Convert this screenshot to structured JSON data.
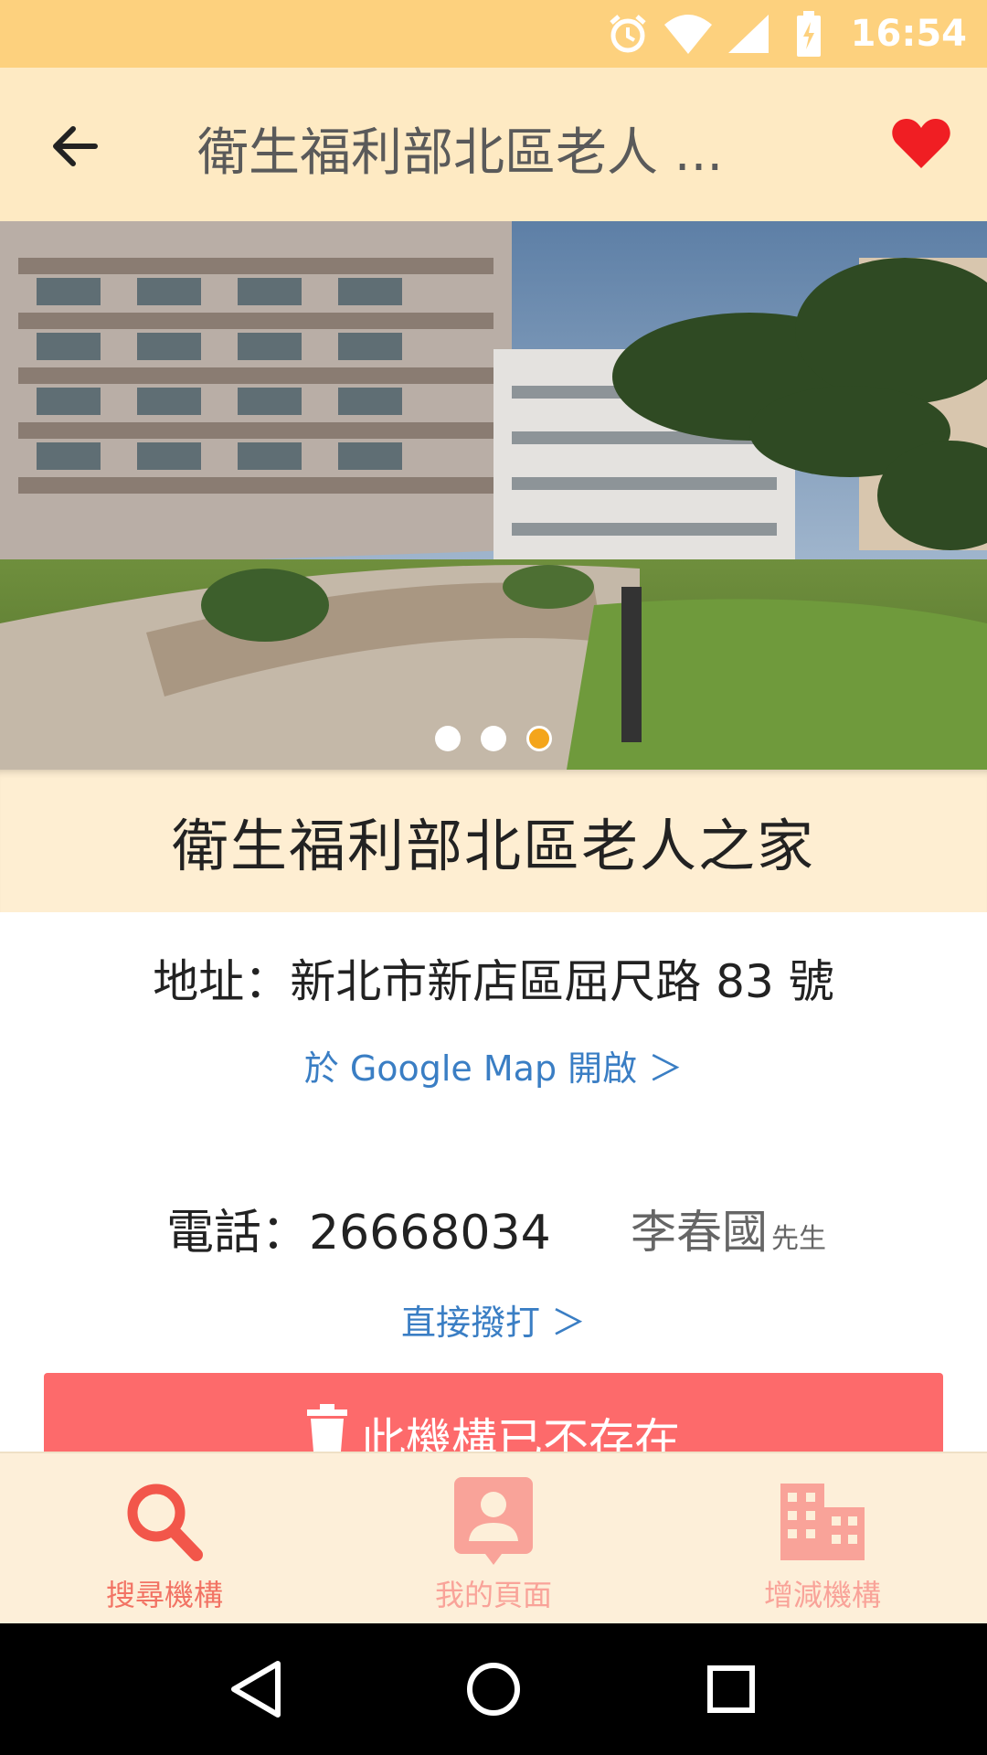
{
  "status_bar": {
    "time": "16:54",
    "icons": [
      "alarm-icon",
      "wifi-icon",
      "signal-icon",
      "battery-charging-icon"
    ]
  },
  "app_bar": {
    "title": "衛生福利部北區老人 ...",
    "back_icon": "arrow-left-icon",
    "favorite_icon": "heart-icon",
    "favorite_color": "#f01e23"
  },
  "carousel": {
    "image": "building-courtyard-photo",
    "page_count": 3,
    "active_index": 2
  },
  "facility": {
    "name": "衛生福利部北區老人之家",
    "address": "地址：新北市新店區屈尺路 83 號",
    "map_link": "於 Google Map 開啟 ＞",
    "phone": "電話：26668034",
    "contact_name": "李春國",
    "contact_title": "先生",
    "call_link": "直接撥打 ＞"
  },
  "remove_button": {
    "label": "此機構已不存在",
    "icon": "trash-icon",
    "color": "#fd6a6b"
  },
  "bottom_nav": {
    "items": [
      {
        "label": "搜尋機構",
        "icon": "search-icon",
        "active": true
      },
      {
        "label": "我的頁面",
        "icon": "profile-icon",
        "active": false
      },
      {
        "label": "增減機構",
        "icon": "building-icon",
        "active": false
      }
    ]
  },
  "system_nav": {
    "buttons": [
      "back-triangle-icon",
      "home-circle-icon",
      "recents-square-icon"
    ]
  },
  "colors": {
    "status_bar": "#fdd17e",
    "app_bar": "#feeac3",
    "link": "#3a7ec4",
    "accent": "#f27364"
  }
}
